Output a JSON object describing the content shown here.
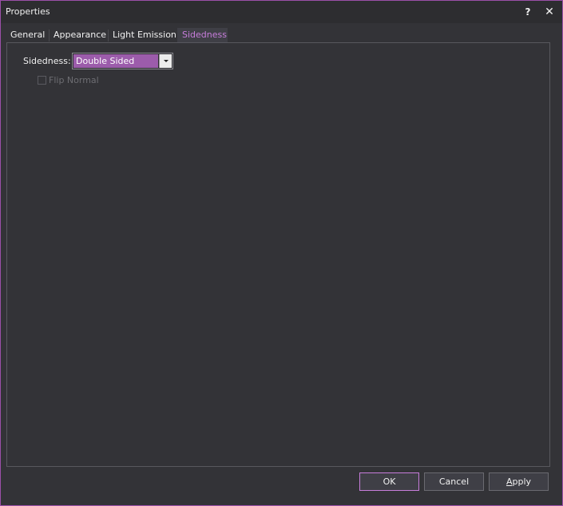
{
  "window": {
    "title": "Properties",
    "help_glyph": "?",
    "close_glyph": "✕"
  },
  "tabs": [
    {
      "label": "General",
      "active": false
    },
    {
      "label": "Appearance",
      "active": false
    },
    {
      "label": "Light Emission",
      "active": false
    },
    {
      "label": "Sidedness",
      "active": true
    }
  ],
  "sidedness": {
    "label": "Sidedness:",
    "selected": "Double Sided"
  },
  "flip_normal": {
    "label": "Flip Normal",
    "checked": false,
    "enabled": false
  },
  "buttons": {
    "ok": "OK",
    "cancel": "Cancel",
    "apply_mnemonic": "A",
    "apply_rest": "pply"
  },
  "colors": {
    "accent": "#c77ddb",
    "selection": "#9c5cab",
    "background": "#333337"
  }
}
